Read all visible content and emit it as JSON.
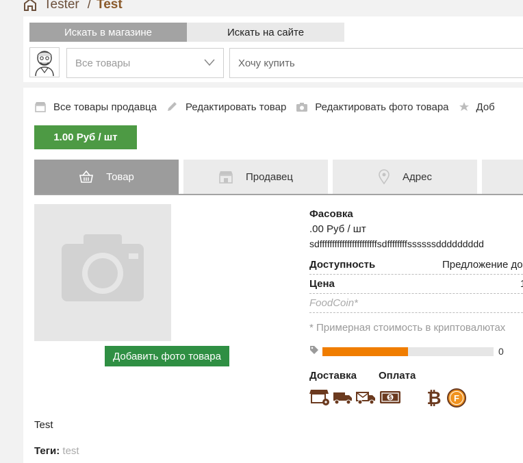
{
  "breadcrumb": {
    "user": "Tester",
    "separator": "/",
    "current": "Test"
  },
  "search": {
    "tabs": [
      "Искать в магазине",
      "Искать на сайте"
    ],
    "category": "Все товары",
    "placeholder": "Хочу купить"
  },
  "actions": [
    "Все товары продавца",
    "Редактировать товар",
    "Редактировать фото товара",
    "Доб"
  ],
  "price_button": "1.00 Руб / шт",
  "tabs": [
    "Товар",
    "Продавец",
    "Адрес"
  ],
  "photo": {
    "add_label": "Добавить фото товара"
  },
  "info": {
    "pack_label": "Фасовка",
    "pack_price": ".00 Руб / шт",
    "pack_long": "sdfffffffffffffffffffffffsdffffffffssssssddddddddd",
    "avail_label": "Доступность",
    "avail_value": "Предложение до",
    "price_label": "Цена",
    "price_value": "1",
    "coin_label": "FoodCoin*",
    "crypto_note": "* Примерная стоимость в криптовалютах",
    "progress_fraction": 0.5,
    "progress_value": "0",
    "delivery_label": "Доставка",
    "payment_label": "Оплата"
  },
  "description": "Test",
  "tags": {
    "label": "Теги:",
    "value": "test"
  },
  "colors": {
    "accent_green": "#4d9a44",
    "button_green": "#2f8f43",
    "progress_orange": "#f07d00",
    "brown": "#6b3a1f",
    "coin_orange": "#f0921e"
  },
  "icons": [
    "home-icon",
    "store-icon",
    "pencil-icon",
    "camera-icon",
    "star-icon",
    "basket-icon",
    "shop-icon",
    "pin-icon",
    "tag-icon",
    "market-stall-icon",
    "truck-icon",
    "mail-truck-icon",
    "cash-icon",
    "bitcoin-icon",
    "foodcoin-icon"
  ]
}
